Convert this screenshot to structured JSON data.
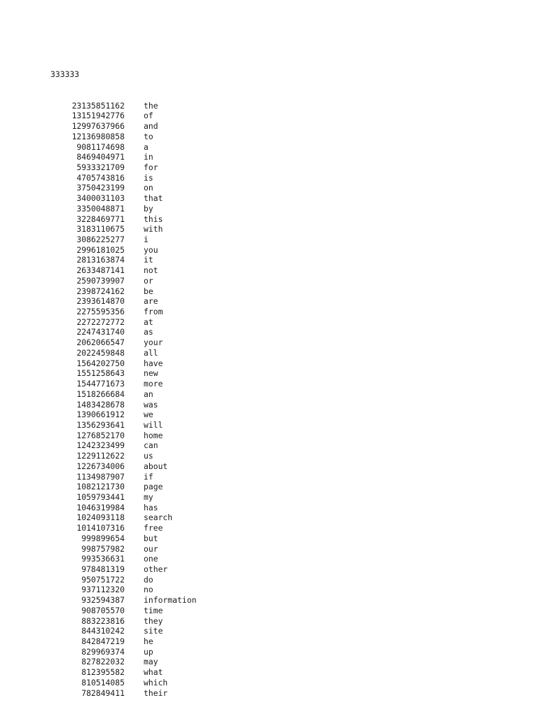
{
  "document": {
    "header_label": "333333",
    "columns": {
      "count_header": "",
      "word_header": ""
    },
    "rows": [
      {
        "count": "23135851162",
        "word": "the"
      },
      {
        "count": "13151942776",
        "word": "of"
      },
      {
        "count": "12997637966",
        "word": "and"
      },
      {
        "count": "12136980858",
        "word": "to"
      },
      {
        "count": "9081174698",
        "word": "a"
      },
      {
        "count": "8469404971",
        "word": "in"
      },
      {
        "count": "5933321709",
        "word": "for"
      },
      {
        "count": "4705743816",
        "word": "is"
      },
      {
        "count": "3750423199",
        "word": "on"
      },
      {
        "count": "3400031103",
        "word": "that"
      },
      {
        "count": "3350048871",
        "word": "by"
      },
      {
        "count": "3228469771",
        "word": "this"
      },
      {
        "count": "3183110675",
        "word": "with"
      },
      {
        "count": "3086225277",
        "word": "i"
      },
      {
        "count": "2996181025",
        "word": "you"
      },
      {
        "count": "2813163874",
        "word": "it"
      },
      {
        "count": "2633487141",
        "word": "not"
      },
      {
        "count": "2590739907",
        "word": "or"
      },
      {
        "count": "2398724162",
        "word": "be"
      },
      {
        "count": "2393614870",
        "word": "are"
      },
      {
        "count": "2275595356",
        "word": "from"
      },
      {
        "count": "2272272772",
        "word": "at"
      },
      {
        "count": "2247431740",
        "word": "as"
      },
      {
        "count": "2062066547",
        "word": "your"
      },
      {
        "count": "2022459848",
        "word": "all"
      },
      {
        "count": "1564202750",
        "word": "have"
      },
      {
        "count": "1551258643",
        "word": "new"
      },
      {
        "count": "1544771673",
        "word": "more"
      },
      {
        "count": "1518266684",
        "word": "an"
      },
      {
        "count": "1483428678",
        "word": "was"
      },
      {
        "count": "1390661912",
        "word": "we"
      },
      {
        "count": "1356293641",
        "word": "will"
      },
      {
        "count": "1276852170",
        "word": "home"
      },
      {
        "count": "1242323499",
        "word": "can"
      },
      {
        "count": "1229112622",
        "word": "us"
      },
      {
        "count": "1226734006",
        "word": "about"
      },
      {
        "count": "1134987907",
        "word": "if"
      },
      {
        "count": "1082121730",
        "word": "page"
      },
      {
        "count": "1059793441",
        "word": "my"
      },
      {
        "count": "1046319984",
        "word": "has"
      },
      {
        "count": "1024093118",
        "word": "search"
      },
      {
        "count": "1014107316",
        "word": "free"
      },
      {
        "count": "999899654",
        "word": "but"
      },
      {
        "count": "998757982",
        "word": "our"
      },
      {
        "count": "993536631",
        "word": "one"
      },
      {
        "count": "978481319",
        "word": "other"
      },
      {
        "count": "950751722",
        "word": "do"
      },
      {
        "count": "937112320",
        "word": "no"
      },
      {
        "count": "932594387",
        "word": "information"
      },
      {
        "count": "908705570",
        "word": "time"
      },
      {
        "count": "883223816",
        "word": "they"
      },
      {
        "count": "844310242",
        "word": "site"
      },
      {
        "count": "842847219",
        "word": "he"
      },
      {
        "count": "829969374",
        "word": "up"
      },
      {
        "count": "827822032",
        "word": "may"
      },
      {
        "count": "812395582",
        "word": "what"
      },
      {
        "count": "810514085",
        "word": "which"
      },
      {
        "count": "782849411",
        "word": "their"
      }
    ]
  },
  "style": {
    "text_color": "#1c1c1c",
    "background_color": "#ffffff"
  }
}
